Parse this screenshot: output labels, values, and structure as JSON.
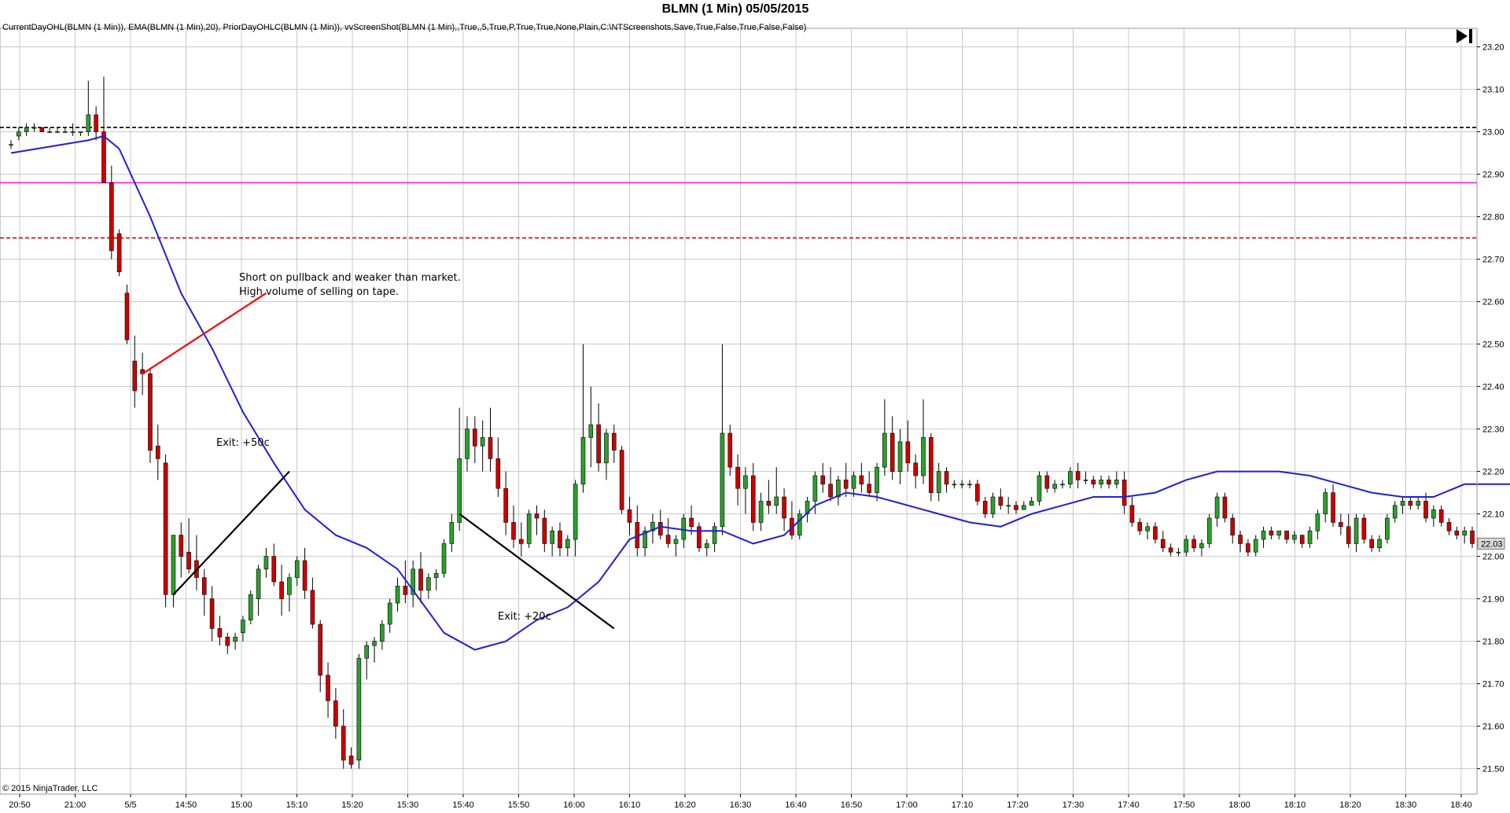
{
  "title": "BLMN (1 Min)  05/05/2015",
  "indicators_label": "CurrentDayOHL(BLMN (1 Min)), EMA(BLMN (1 Min),20), PriorDayOHLC(BLMN (1 Min)), vvScreenShot(BLMN (1 Min),,True,,5,True,P,True,True,None,Plain,C:\\NTScreenshots,Save,True,False,True,False,False)",
  "copyright": "© 2015 NinjaTrader, LLC",
  "colors": {
    "up_candle": "#2ca02c",
    "down_candle": "#cc0000",
    "ema": "#1f1fdd",
    "prior_high": "#000000",
    "prior_close": "#ee22ee",
    "prior_low": "#dd0000",
    "grid": "#c8c8c8",
    "last_price_box": "#d9d9d9"
  },
  "icons": {
    "panel_toggle": "play-bar-icon"
  },
  "annotations": {
    "short_text_line1": "Short on pullback and weaker than market.",
    "short_text_line2": "High volume of selling on tape.",
    "exit1": "Exit: +50c",
    "exit2": "Exit: +20c"
  },
  "chart_data": {
    "type": "candlestick",
    "y_range": [
      21.44,
      23.24
    ],
    "y_ticks": [
      "23.20",
      "23.10",
      "23.00",
      "22.90",
      "22.80",
      "22.70",
      "22.60",
      "22.50",
      "22.40",
      "22.30",
      "22.20",
      "22.10",
      "22.00",
      "21.90",
      "21.80",
      "21.70",
      "21.60",
      "21.50"
    ],
    "x_ticks": [
      "20:50",
      "21:00",
      "5/5",
      "14:50",
      "15:00",
      "15:10",
      "15:20",
      "15:30",
      "15:40",
      "15:50",
      "16:00",
      "16:10",
      "16:20",
      "16:30",
      "16:40",
      "16:50",
      "17:00",
      "17:10",
      "17:20",
      "17:30",
      "17:40",
      "17:50",
      "18:00",
      "18:10",
      "18:20",
      "18:30",
      "18:40"
    ],
    "last_price": "22.03",
    "horizontal_lines": [
      {
        "label": "prior_high",
        "value": 23.01,
        "style": "dashed",
        "color": "#000000"
      },
      {
        "label": "prior_close",
        "value": 22.88,
        "style": "solid",
        "color": "#ee22ee"
      },
      {
        "label": "prior_low",
        "value": 22.75,
        "style": "dashed",
        "color": "#dd0000"
      }
    ],
    "series": [
      {
        "name": "EMA(BLMN (1 Min),20)",
        "type": "line"
      },
      {
        "name": "BLMN (1 Min)",
        "type": "candlestick"
      }
    ],
    "ema_key_points": [
      [
        0,
        22.95
      ],
      [
        10,
        22.98
      ],
      [
        12,
        22.99
      ],
      [
        14,
        22.96
      ],
      [
        18,
        22.8
      ],
      [
        22,
        22.62
      ],
      [
        26,
        22.49
      ],
      [
        30,
        22.34
      ],
      [
        34,
        22.22
      ],
      [
        38,
        22.11
      ],
      [
        42,
        22.05
      ],
      [
        46,
        22.02
      ],
      [
        50,
        21.97
      ],
      [
        52,
        21.92
      ],
      [
        56,
        21.82
      ],
      [
        60,
        21.78
      ],
      [
        64,
        21.8
      ],
      [
        68,
        21.85
      ],
      [
        72,
        21.88
      ],
      [
        76,
        21.94
      ],
      [
        78,
        21.99
      ],
      [
        80,
        22.04
      ],
      [
        84,
        22.07
      ],
      [
        88,
        22.06
      ],
      [
        92,
        22.06
      ],
      [
        96,
        22.03
      ],
      [
        100,
        22.05
      ],
      [
        104,
        22.12
      ],
      [
        108,
        22.15
      ],
      [
        112,
        22.14
      ],
      [
        116,
        22.12
      ],
      [
        120,
        22.1
      ],
      [
        124,
        22.08
      ],
      [
        128,
        22.07
      ],
      [
        132,
        22.1
      ],
      [
        136,
        22.12
      ],
      [
        140,
        22.14
      ],
      [
        144,
        22.14
      ],
      [
        148,
        22.15
      ],
      [
        152,
        22.18
      ],
      [
        156,
        22.2
      ],
      [
        160,
        22.2
      ],
      [
        164,
        22.2
      ],
      [
        168,
        22.19
      ],
      [
        172,
        22.17
      ],
      [
        176,
        22.15
      ],
      [
        180,
        22.14
      ],
      [
        184,
        22.14
      ],
      [
        188,
        22.17
      ],
      [
        192,
        22.17
      ],
      [
        196,
        22.17
      ],
      [
        200,
        22.16
      ],
      [
        204,
        22.13
      ],
      [
        208,
        22.09
      ],
      [
        212,
        22.07
      ],
      [
        216,
        22.05
      ],
      [
        220,
        22.05
      ],
      [
        224,
        22.07
      ],
      [
        228,
        22.06
      ],
      [
        232,
        22.06
      ],
      [
        236,
        22.05
      ],
      [
        240,
        22.06
      ],
      [
        244,
        22.07
      ],
      [
        248,
        22.07
      ],
      [
        252,
        22.08
      ],
      [
        256,
        22.07
      ],
      [
        260,
        22.09
      ],
      [
        264,
        22.09
      ],
      [
        268,
        22.09
      ],
      [
        272,
        22.08
      ],
      [
        276,
        22.07
      ]
    ],
    "ohlc": [
      [
        22.97,
        22.98,
        22.96,
        22.97
      ],
      [
        22.99,
        23.01,
        22.98,
        23.0
      ],
      [
        23.0,
        23.02,
        22.99,
        23.01
      ],
      [
        23.01,
        23.02,
        23.0,
        23.01
      ],
      [
        23.01,
        23.01,
        23.0,
        23.0
      ],
      [
        23.0,
        23.01,
        23.0,
        23.0
      ],
      [
        23.0,
        23.01,
        23.0,
        23.0
      ],
      [
        23.0,
        23.01,
        23.0,
        23.0
      ],
      [
        23.0,
        23.02,
        22.99,
        23.0
      ],
      [
        23.0,
        23.0,
        22.99,
        23.0
      ],
      [
        23.0,
        23.12,
        22.99,
        23.04
      ],
      [
        23.04,
        23.06,
        22.98,
        23.0
      ],
      [
        23.0,
        23.13,
        22.9,
        22.88
      ],
      [
        22.88,
        22.92,
        22.7,
        22.72
      ],
      [
        22.76,
        22.77,
        22.66,
        22.67
      ],
      [
        22.62,
        22.64,
        22.5,
        22.51
      ],
      [
        22.46,
        22.52,
        22.35,
        22.39
      ],
      [
        22.44,
        22.48,
        22.38,
        22.43
      ],
      [
        22.43,
        22.44,
        22.22,
        22.25
      ],
      [
        22.26,
        22.31,
        22.18,
        22.23
      ],
      [
        22.22,
        22.24,
        21.88,
        21.91
      ],
      [
        21.91,
        22.05,
        21.88,
        22.05
      ],
      [
        22.05,
        22.08,
        21.95,
        22.0
      ],
      [
        22.01,
        22.09,
        21.96,
        21.97
      ],
      [
        21.99,
        22.05,
        21.92,
        21.95
      ],
      [
        21.95,
        21.97,
        21.86,
        21.91
      ],
      [
        21.9,
        21.93,
        21.8,
        21.83
      ],
      [
        21.83,
        21.86,
        21.79,
        21.81
      ],
      [
        21.81,
        21.82,
        21.77,
        21.79
      ],
      [
        21.8,
        21.82,
        21.78,
        21.81
      ],
      [
        21.82,
        21.86,
        21.8,
        21.85
      ],
      [
        21.85,
        21.92,
        21.84,
        21.91
      ],
      [
        21.9,
        21.98,
        21.86,
        21.97
      ],
      [
        21.97,
        22.02,
        21.95,
        22.0
      ],
      [
        22.0,
        22.03,
        21.93,
        21.94
      ],
      [
        21.94,
        21.98,
        21.86,
        21.9
      ],
      [
        21.91,
        21.96,
        21.87,
        21.95
      ],
      [
        21.95,
        22.0,
        21.93,
        21.99
      ],
      [
        21.99,
        22.02,
        21.9,
        21.92
      ],
      [
        21.92,
        21.95,
        21.83,
        21.84
      ],
      [
        21.84,
        21.85,
        21.68,
        21.72
      ],
      [
        21.72,
        21.75,
        21.62,
        21.66
      ],
      [
        21.66,
        21.69,
        21.57,
        21.6
      ],
      [
        21.6,
        21.64,
        21.5,
        21.52
      ],
      [
        21.53,
        21.55,
        21.5,
        21.51
      ],
      [
        21.52,
        21.77,
        21.5,
        21.76
      ],
      [
        21.76,
        21.8,
        21.71,
        21.79
      ],
      [
        21.79,
        21.81,
        21.75,
        21.8
      ],
      [
        21.8,
        21.85,
        21.78,
        21.84
      ],
      [
        21.84,
        21.9,
        21.82,
        21.89
      ],
      [
        21.89,
        21.95,
        21.87,
        21.93
      ],
      [
        21.93,
        21.99,
        21.89,
        21.91
      ],
      [
        21.91,
        21.99,
        21.88,
        21.97
      ],
      [
        21.97,
        22.01,
        21.89,
        21.92
      ],
      [
        21.92,
        21.96,
        21.9,
        21.95
      ],
      [
        21.95,
        21.97,
        21.92,
        21.96
      ],
      [
        21.96,
        22.04,
        21.95,
        22.03
      ],
      [
        22.03,
        22.1,
        22.01,
        22.08
      ],
      [
        22.08,
        22.35,
        22.06,
        22.23
      ],
      [
        22.23,
        22.33,
        22.2,
        22.3
      ],
      [
        22.3,
        22.33,
        22.22,
        22.26
      ],
      [
        22.26,
        22.32,
        22.2,
        22.28
      ],
      [
        22.28,
        22.35,
        22.2,
        22.23
      ],
      [
        22.23,
        22.28,
        22.14,
        22.16
      ],
      [
        22.16,
        22.2,
        22.05,
        22.08
      ],
      [
        22.08,
        22.12,
        22.02,
        22.04
      ],
      [
        22.04,
        22.08,
        22.0,
        22.03
      ],
      [
        22.03,
        22.11,
        22.02,
        22.1
      ],
      [
        22.1,
        22.12,
        22.05,
        22.09
      ],
      [
        22.09,
        22.11,
        22.01,
        22.03
      ],
      [
        22.03,
        22.07,
        22.0,
        22.06
      ],
      [
        22.06,
        22.08,
        22.0,
        22.02
      ],
      [
        22.02,
        22.05,
        22.0,
        22.04
      ],
      [
        22.04,
        22.18,
        22.0,
        22.17
      ],
      [
        22.17,
        22.5,
        22.15,
        22.28
      ],
      [
        22.28,
        22.4,
        22.21,
        22.31
      ],
      [
        22.31,
        22.36,
        22.2,
        22.22
      ],
      [
        22.22,
        22.3,
        22.18,
        22.29
      ],
      [
        22.29,
        22.31,
        22.22,
        22.25
      ],
      [
        22.25,
        22.26,
        22.1,
        22.11
      ],
      [
        22.11,
        22.14,
        22.05,
        22.08
      ],
      [
        22.08,
        22.12,
        22.0,
        22.02
      ],
      [
        22.02,
        22.07,
        22.0,
        22.06
      ],
      [
        22.06,
        22.1,
        22.03,
        22.08
      ],
      [
        22.08,
        22.11,
        22.04,
        22.05
      ],
      [
        22.05,
        22.09,
        22.02,
        22.03
      ],
      [
        22.03,
        22.05,
        22.0,
        22.04
      ],
      [
        22.04,
        22.1,
        22.02,
        22.09
      ],
      [
        22.09,
        22.12,
        22.05,
        22.07
      ],
      [
        22.07,
        22.08,
        22.01,
        22.02
      ],
      [
        22.02,
        22.04,
        22.0,
        22.03
      ],
      [
        22.03,
        22.08,
        22.01,
        22.07
      ],
      [
        22.07,
        22.5,
        22.05,
        22.29
      ],
      [
        22.29,
        22.31,
        22.19,
        22.21
      ],
      [
        22.21,
        22.24,
        22.12,
        22.16
      ],
      [
        22.16,
        22.21,
        22.1,
        22.19
      ],
      [
        22.19,
        22.22,
        22.06,
        22.08
      ],
      [
        22.08,
        22.15,
        22.06,
        22.13
      ],
      [
        22.13,
        22.18,
        22.1,
        22.12
      ],
      [
        22.12,
        22.21,
        22.1,
        22.14
      ],
      [
        22.14,
        22.16,
        22.06,
        22.09
      ],
      [
        22.09,
        22.13,
        22.04,
        22.05
      ],
      [
        22.05,
        22.11,
        22.04,
        22.1
      ],
      [
        22.1,
        22.14,
        22.08,
        22.13
      ],
      [
        22.13,
        22.2,
        22.1,
        22.19
      ],
      [
        22.19,
        22.22,
        22.15,
        22.17
      ],
      [
        22.17,
        22.21,
        22.13,
        22.14
      ],
      [
        22.14,
        22.19,
        22.12,
        22.18
      ],
      [
        22.18,
        22.22,
        22.14,
        22.16
      ],
      [
        22.16,
        22.2,
        22.14,
        22.19
      ],
      [
        22.19,
        22.22,
        22.15,
        22.17
      ],
      [
        22.17,
        22.2,
        22.14,
        22.15
      ],
      [
        22.15,
        22.22,
        22.13,
        22.21
      ],
      [
        22.21,
        22.37,
        22.19,
        22.29
      ],
      [
        22.29,
        22.33,
        22.18,
        22.2
      ],
      [
        22.2,
        22.3,
        22.17,
        22.27
      ],
      [
        22.27,
        22.32,
        22.2,
        22.22
      ],
      [
        22.22,
        22.24,
        22.16,
        22.19
      ],
      [
        22.19,
        22.37,
        22.17,
        22.28
      ],
      [
        22.28,
        22.29,
        22.13,
        22.15
      ],
      [
        22.15,
        22.22,
        22.13,
        22.2
      ],
      [
        22.2,
        22.21,
        22.15,
        22.17
      ],
      [
        22.17,
        22.18,
        22.16,
        22.17
      ],
      [
        22.17,
        22.18,
        22.16,
        22.17
      ],
      [
        22.17,
        22.18,
        22.16,
        22.17
      ],
      [
        22.17,
        22.18,
        22.12,
        22.13
      ],
      [
        22.13,
        22.14,
        22.09,
        22.1
      ],
      [
        22.1,
        22.15,
        22.09,
        22.14
      ],
      [
        22.14,
        22.16,
        22.11,
        22.12
      ],
      [
        22.12,
        22.14,
        22.1,
        22.12
      ],
      [
        22.12,
        22.13,
        22.1,
        22.11
      ],
      [
        22.11,
        22.13,
        22.11,
        22.12
      ],
      [
        22.12,
        22.14,
        22.12,
        22.13
      ],
      [
        22.13,
        22.2,
        22.12,
        22.19
      ],
      [
        22.19,
        22.2,
        22.15,
        22.16
      ],
      [
        22.16,
        22.18,
        22.15,
        22.17
      ],
      [
        22.17,
        22.18,
        22.16,
        22.17
      ],
      [
        22.17,
        22.21,
        22.16,
        22.2
      ],
      [
        22.2,
        22.22,
        22.16,
        22.18
      ],
      [
        22.18,
        22.2,
        22.17,
        22.18
      ],
      [
        22.18,
        22.19,
        22.16,
        22.17
      ],
      [
        22.17,
        22.19,
        22.16,
        22.18
      ],
      [
        22.18,
        22.19,
        22.16,
        22.17
      ],
      [
        22.17,
        22.2,
        22.16,
        22.18
      ],
      [
        22.18,
        22.2,
        22.1,
        22.12
      ],
      [
        22.12,
        22.14,
        22.07,
        22.08
      ],
      [
        22.08,
        22.09,
        22.05,
        22.06
      ],
      [
        22.06,
        22.08,
        22.04,
        22.07
      ],
      [
        22.07,
        22.08,
        22.03,
        22.04
      ],
      [
        22.04,
        22.06,
        22.01,
        22.02
      ],
      [
        22.02,
        22.03,
        22.0,
        22.01
      ],
      [
        22.01,
        22.02,
        22.0,
        22.01
      ],
      [
        22.01,
        22.05,
        22.0,
        22.04
      ],
      [
        22.04,
        22.05,
        22.01,
        22.02
      ],
      [
        22.02,
        22.04,
        22.0,
        22.03
      ],
      [
        22.03,
        22.1,
        22.02,
        22.09
      ],
      [
        22.09,
        22.15,
        22.07,
        22.14
      ],
      [
        22.14,
        22.15,
        22.08,
        22.09
      ],
      [
        22.09,
        22.1,
        22.03,
        22.05
      ],
      [
        22.05,
        22.06,
        22.01,
        22.03
      ],
      [
        22.03,
        22.04,
        22.0,
        22.01
      ],
      [
        22.01,
        22.05,
        22.0,
        22.04
      ],
      [
        22.04,
        22.07,
        22.02,
        22.06
      ],
      [
        22.06,
        22.07,
        22.04,
        22.05
      ],
      [
        22.05,
        22.06,
        22.04,
        22.06
      ],
      [
        22.06,
        22.06,
        22.03,
        22.04
      ],
      [
        22.04,
        22.06,
        22.03,
        22.05
      ],
      [
        22.05,
        22.05,
        22.02,
        22.03
      ],
      [
        22.03,
        22.07,
        22.02,
        22.06
      ],
      [
        22.06,
        22.11,
        22.04,
        22.1
      ],
      [
        22.1,
        22.16,
        22.08,
        22.15
      ],
      [
        22.15,
        22.17,
        22.07,
        22.08
      ],
      [
        22.08,
        22.1,
        22.05,
        22.07
      ],
      [
        22.07,
        22.1,
        22.02,
        22.03
      ],
      [
        22.03,
        22.1,
        22.01,
        22.09
      ],
      [
        22.09,
        22.1,
        22.03,
        22.04
      ],
      [
        22.04,
        22.05,
        22.01,
        22.02
      ],
      [
        22.02,
        22.05,
        22.01,
        22.04
      ],
      [
        22.04,
        22.1,
        22.03,
        22.09
      ],
      [
        22.09,
        22.13,
        22.08,
        22.12
      ],
      [
        22.12,
        22.14,
        22.1,
        22.13
      ],
      [
        22.13,
        22.14,
        22.11,
        22.12
      ],
      [
        22.12,
        22.14,
        22.11,
        22.13
      ],
      [
        22.13,
        22.15,
        22.08,
        22.09
      ],
      [
        22.09,
        22.12,
        22.07,
        22.11
      ],
      [
        22.11,
        22.12,
        22.07,
        22.08
      ],
      [
        22.08,
        22.09,
        22.05,
        22.06
      ],
      [
        22.06,
        22.07,
        22.04,
        22.05
      ],
      [
        22.05,
        22.07,
        22.03,
        22.06
      ],
      [
        22.06,
        22.07,
        22.02,
        22.03
      ]
    ]
  }
}
